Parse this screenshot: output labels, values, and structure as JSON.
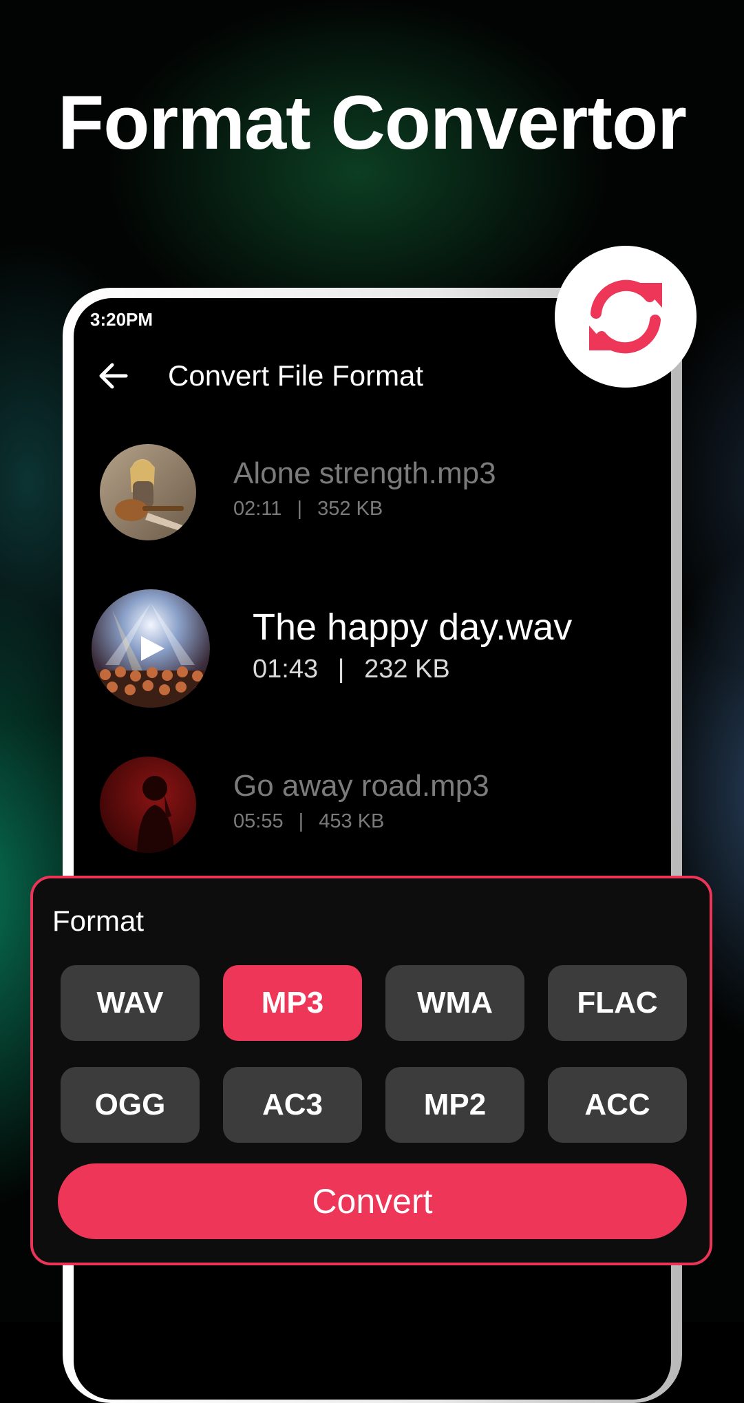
{
  "headline": "Format Convertor",
  "status_bar": {
    "time": "3:20PM"
  },
  "header": {
    "title": "Convert File Format",
    "back_icon": "arrow-left-icon"
  },
  "tracks": [
    {
      "name": "Alone strength.mp3",
      "duration": "02:11",
      "size": "352 KB",
      "active": false
    },
    {
      "name": "The happy day.wav",
      "duration": "01:43",
      "size": "232 KB",
      "active": true
    },
    {
      "name": "Go away road.mp3",
      "duration": "05:55",
      "size": "453 KB",
      "active": false
    }
  ],
  "format_panel": {
    "title": "Format",
    "options": [
      "WAV",
      "MP3",
      "WMA",
      "FLAC",
      "OGG",
      "AC3",
      "MP2",
      "ACC"
    ],
    "selected": "MP3",
    "convert_label": "Convert"
  },
  "separator": "|",
  "colors": {
    "accent": "#ed3658",
    "option_bg": "#3c3c3c",
    "panel_bg": "#0d0d0d"
  }
}
